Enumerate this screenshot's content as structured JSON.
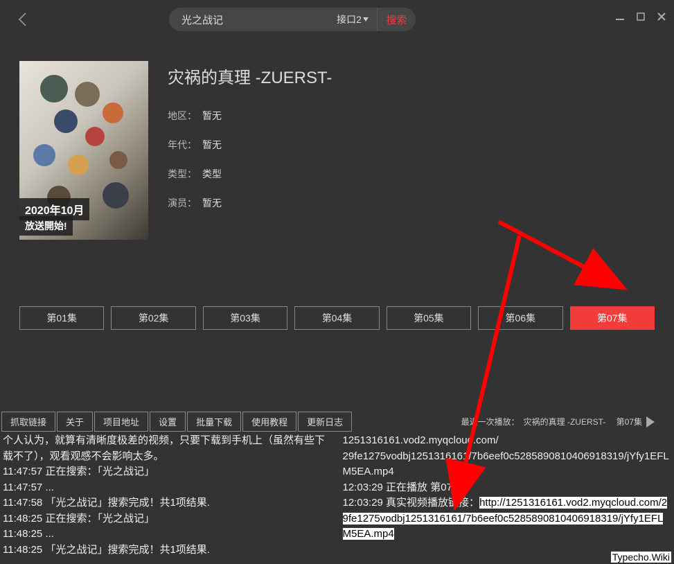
{
  "header": {
    "search_value": "光之战记",
    "interface_label": "接口2",
    "search_button": "搜索"
  },
  "detail": {
    "title": "灾祸的真理 -ZUERST-",
    "region_label": "地区：",
    "region_value": "暂无",
    "year_label": "年代：",
    "year_value": "暂无",
    "type_label": "类型：",
    "type_value": "类型",
    "actor_label": "演员：",
    "actor_value": "暂无",
    "poster_line1": "2020年10月",
    "poster_line2": "放送開始!"
  },
  "episodes": [
    {
      "label": "第01集",
      "active": false
    },
    {
      "label": "第02集",
      "active": false
    },
    {
      "label": "第03集",
      "active": false
    },
    {
      "label": "第04集",
      "active": false
    },
    {
      "label": "第05集",
      "active": false
    },
    {
      "label": "第06集",
      "active": false
    },
    {
      "label": "第07集",
      "active": true
    }
  ],
  "tabs": [
    "抓取链接",
    "关于",
    "项目地址",
    "设置",
    "批量下载",
    "使用教程",
    "更新日志"
  ],
  "recent": {
    "prefix": "最近一次播放：",
    "title": "灾祸的真理 -ZUERST-",
    "ep": "第07集"
  },
  "log_left": [
    "个人认为，就算有清晰度极差的视频，只要下载到手机上（虽然有些下载不了），观看观感不会影响太多。",
    "11:47:57 正在搜索：「光之战记」",
    "11:47:57 ...",
    "11:47:58 「光之战记」搜索完成！共1项结果.",
    "11:48:25 正在搜索：「光之战记」",
    "11:48:25 ...",
    "11:48:25 「光之战记」搜索完成！共1项结果."
  ],
  "log_right": {
    "line1": "1251316161.vod2.myqcloud.com/",
    "line2": "29fe1275vodbj1251316161/7b6eef0c5285890810406918319/jYfy1EFLM5EA.mp4",
    "line3": "12:03:29 正在播放    第07集",
    "line4_prefix": "12:03:29 真实视频播放链接：",
    "line4_url": "http://1251316161.vod2.myqcloud.com/29fe1275vodbj1251316161/7b6eef0c5285890810406918319/jYfy1EFLM5EA.mp4"
  },
  "watermark": "Typecho.Wiki"
}
